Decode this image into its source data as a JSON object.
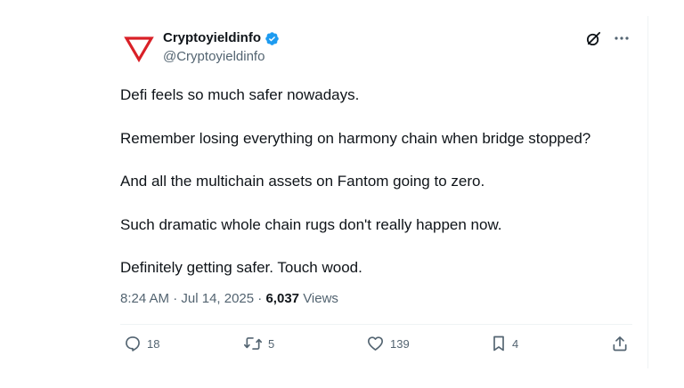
{
  "tweet": {
    "author": {
      "name": "Cryptoyieldinfo",
      "handle": "@Cryptoyieldinfo",
      "verified": true,
      "avatar_icon": "red-triangle-logo-icon",
      "brand_color": "#d92027"
    },
    "header_actions": {
      "grok_icon": "grok-icon",
      "more_icon": "more-icon"
    },
    "paragraphs": [
      "Defi feels so much safer nowadays.",
      "Remember losing everything on harmony chain when bridge stopped?",
      "And all the multichain assets on Fantom going to zero.",
      "Such dramatic whole chain rugs don't really happen now.",
      "Definitely getting safer. Touch wood."
    ],
    "meta": {
      "time": "8:24 AM",
      "separator": "·",
      "date": "Jul 14, 2025",
      "views_count": "6,037",
      "views_label": "Views"
    },
    "actions": {
      "replies": "18",
      "reposts": "5",
      "likes": "139",
      "bookmarks": "4"
    }
  },
  "colors": {
    "text_primary": "#0f1419",
    "text_secondary": "#536471",
    "verified_blue": "#1d9bf0",
    "divider": "#eff3f4"
  }
}
